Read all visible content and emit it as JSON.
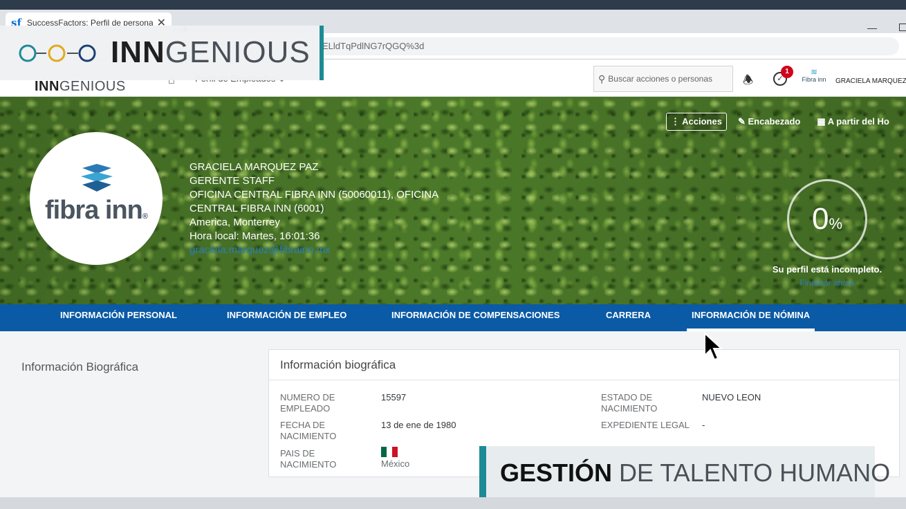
{
  "browser": {
    "tab_title": "SuccessFactors: Perfil de persona",
    "tab_icon": "sf",
    "new_tab": "+",
    "close_tab": "✕",
    "url_visible": "ELldTqPdlNG7rQGQ%3d"
  },
  "header": {
    "logo_bold": "INN",
    "logo_rest": "GENIOUS",
    "module": "Perfil de Empleados ⌄",
    "search_placeholder": "Buscar acciones o personas",
    "todo_badge": "1",
    "company_short": "Fibra inn",
    "user_name": "GRACIELA MARQUEZ"
  },
  "profile": {
    "logo_text": "fibra inn",
    "logo_reg": "®",
    "name": "GRACIELA MARQUEZ PAZ",
    "title": "GERENTE STAFF",
    "department": "OFICINA CENTRAL FIBRA INN (50060011), OFICINA CENTRAL FIBRA INN (6001)",
    "location": "America, Monterrey",
    "local_time": "Hora local: Martes, 16:01:36",
    "email": "graciela.marquez@fibrainn.mx",
    "actions_label": "Acciones",
    "header_label": "Encabezado",
    "from_label": "A partir del Ho",
    "completeness_value": "0",
    "completeness_unit": "%",
    "completeness_caption": "Su perfil está incompleto.",
    "completeness_link": "Finalizar ahora"
  },
  "tabs": [
    {
      "label": "INFORMACIÓN PERSONAL"
    },
    {
      "label": "INFORMACIÓN DE EMPLEO"
    },
    {
      "label": "INFORMACIÓN DE COMPENSACIONES"
    },
    {
      "label": "CARRERA"
    },
    {
      "label": "INFORMACIÓN DE NÓMINA",
      "active": true
    }
  ],
  "section": {
    "nav_title": "Información Biográfica",
    "card_title": "Información biográfica",
    "fields": [
      {
        "label": "NUMERO DE EMPLEADO",
        "value": "15597"
      },
      {
        "label": "FECHA DE NACIMIENTO",
        "value": "13 de ene de 1980"
      },
      {
        "label": "PAIS DE NACIMIENTO",
        "value": "México"
      },
      {
        "label": "ESTADO DE NACIMIENTO",
        "value": "NUEVO LEON"
      },
      {
        "label": "EXPEDIENTE LEGAL",
        "value": "-"
      }
    ]
  },
  "overlay": {
    "brand_bold": "INN",
    "brand_rest": "GENIOUS",
    "lower_bold": "GESTIÓN",
    "lower_rest": " DE TALENTO HUMANO"
  },
  "colors": {
    "tab_bar": "#0a5aa6",
    "accent_teal": "#1e8a96",
    "link": "#2d7fb8",
    "badge": "#d0021b"
  }
}
